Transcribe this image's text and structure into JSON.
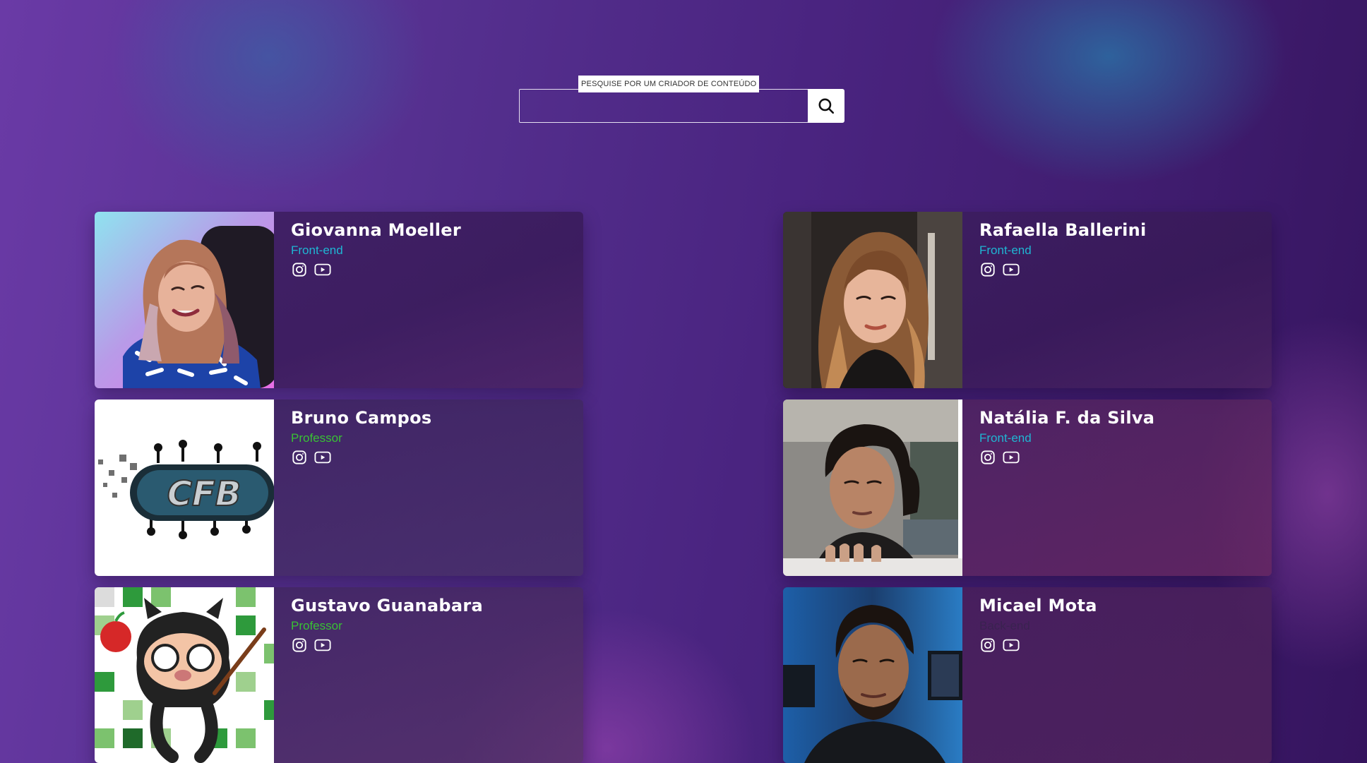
{
  "search": {
    "label": "PESQUISE POR UM CRIADOR DE CONTEÚDO",
    "value": "",
    "icon": "search-icon"
  },
  "creators": [
    {
      "name": "Giovanna Moeller",
      "role": "Front-end",
      "role_color": "#1fb6d3",
      "links": [
        "instagram-icon",
        "youtube-icon"
      ]
    },
    {
      "name": "Rafaella Ballerini",
      "role": "Front-end",
      "role_color": "#1fb6d3",
      "links": [
        "instagram-icon",
        "youtube-icon"
      ]
    },
    {
      "name": "Bruno Campos",
      "role": "Professor",
      "role_color": "#39c234",
      "links": [
        "instagram-icon",
        "youtube-icon"
      ]
    },
    {
      "name": "Natália F. da Silva",
      "role": "Front-end",
      "role_color": "#1fb6d3",
      "links": [
        "instagram-icon",
        "youtube-icon"
      ]
    },
    {
      "name": "Gustavo Guanabara",
      "role": "Professor",
      "role_color": "#39c234",
      "links": [
        "instagram-icon",
        "youtube-icon"
      ]
    },
    {
      "name": "Micael Mota",
      "role": "Back-end",
      "role_color": "#3a2250",
      "links": [
        "instagram-icon",
        "youtube-icon"
      ]
    }
  ],
  "logos": {
    "cfb": "CFB"
  }
}
